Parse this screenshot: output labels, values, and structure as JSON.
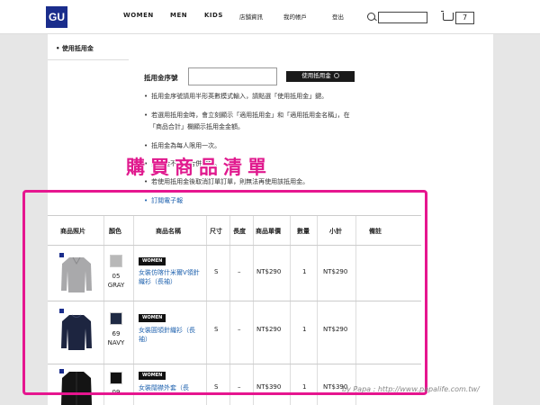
{
  "header": {
    "logo": "GU",
    "nav": [
      "WOMEN",
      "MEN",
      "KIDS",
      "店舗資訊",
      "我的帳戶",
      "登出"
    ],
    "search_value": "",
    "cart_count": "7"
  },
  "sidebar": {
    "title": "• 使用抵用金"
  },
  "voucher": {
    "label": "抵用金序號",
    "input_value": "",
    "button": "使用抵用金",
    "notes": [
      "抵用金序號請用半形英數模式輸入，請點選「使用抵用金」鍵。",
      "若選用抵用金時，會立刻顯示「適用抵用金」和「適用抵用金名稱」，在",
      "「商品合計」欄顯示抵用金金額。",
      "抵用金為每人限用一次。",
      "抵用金不適用合併結帳。",
      "若使用抵用金後取消訂單訂單，則無法再使用該抵用金。",
      "訂閱電子報"
    ]
  },
  "overlay_title": "購買商品清單",
  "table": {
    "headers": [
      "商品照片",
      "顏色",
      "商品名稱",
      "尺寸",
      "長度",
      "商品單價",
      "數量",
      "小計",
      "備註"
    ],
    "rows": [
      {
        "code": "05",
        "color": "GRAY",
        "badge": "WOMEN",
        "name": "女裝仿喀什米爾V領針織衫（長袖）",
        "size": "S",
        "length": "–",
        "unit_price": "NT$290",
        "qty": "1",
        "subtotal": "NT$290",
        "swatch": "#b8b8b8"
      },
      {
        "code": "69",
        "color": "NAVY",
        "badge": "WOMEN",
        "name": "女裝圓領針織衫（長袖）",
        "size": "S",
        "length": "–",
        "unit_price": "NT$290",
        "qty": "1",
        "subtotal": "NT$290",
        "swatch": "#1f2a44"
      },
      {
        "code": "09",
        "color": "",
        "badge": "WOMEN",
        "name": "女裝闊襟外套（長",
        "size": "S",
        "length": "–",
        "unit_price": "NT$390",
        "qty": "1",
        "subtotal": "NT$390",
        "swatch": "#111111"
      }
    ]
  },
  "watermark": "by Papa : http://www.papalife.com.tw/"
}
